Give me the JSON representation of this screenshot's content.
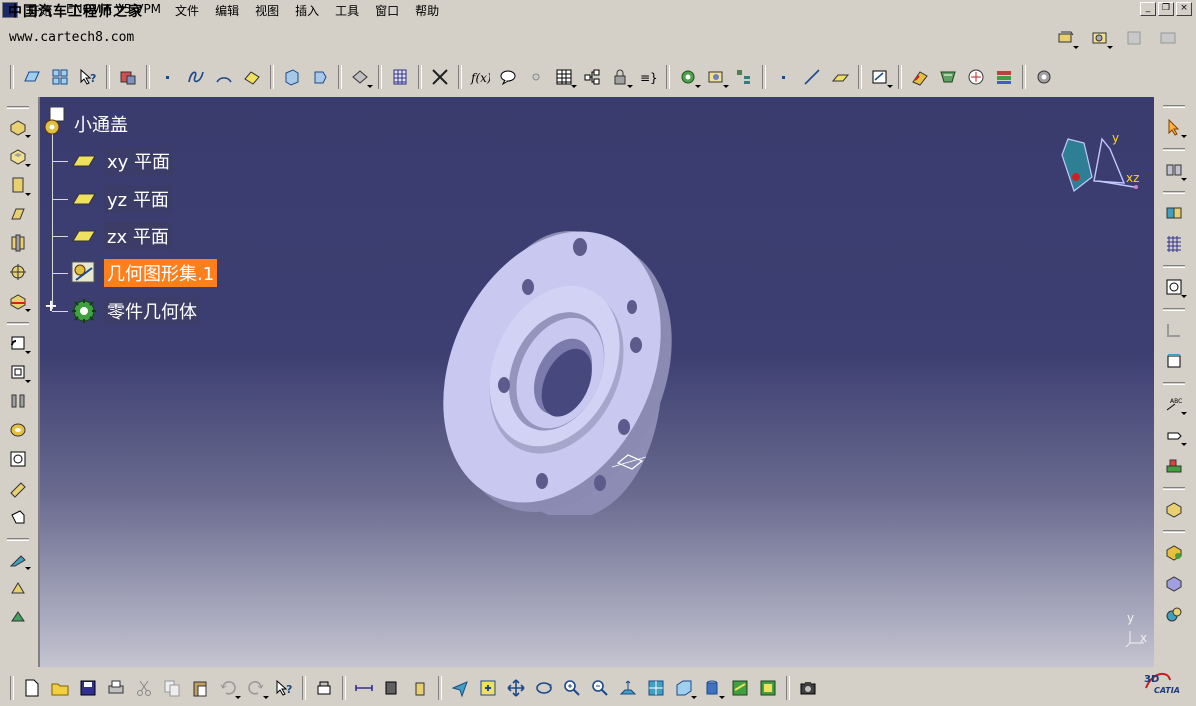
{
  "window": {
    "watermark_title": "中国汽车工程师之家",
    "url": "www.cartech8.com",
    "buttons": [
      "_",
      "❐",
      "×"
    ]
  },
  "menu": {
    "items": [
      "开始",
      "ENOVIA V5 VPM",
      "文件",
      "编辑",
      "视图",
      "插入",
      "工具",
      "窗口",
      "帮助"
    ]
  },
  "tree": {
    "root_label": "小通盖",
    "items": [
      {
        "label": "xy 平面",
        "icon": "plane-icon"
      },
      {
        "label": "yz 平面",
        "icon": "plane-icon"
      },
      {
        "label": "zx 平面",
        "icon": "plane-icon"
      },
      {
        "label": "几何图形集.1",
        "icon": "geometrical-set-icon",
        "selected": true
      },
      {
        "label": "零件几何体",
        "icon": "part-body-icon",
        "expandable": true
      }
    ]
  },
  "viewport": {
    "compass_labels": {
      "y": "y",
      "xz": "xz"
    },
    "axis_labels": {
      "y": "y",
      "x": "x"
    },
    "colors": {
      "background_top": "#3a3b6e",
      "background_bottom": "#c5c4d0",
      "part_face": "#c8c8f0",
      "part_side": "#8c8cb4",
      "selection": "#ff7f1c"
    }
  },
  "logo": {
    "text": "CATIA"
  }
}
